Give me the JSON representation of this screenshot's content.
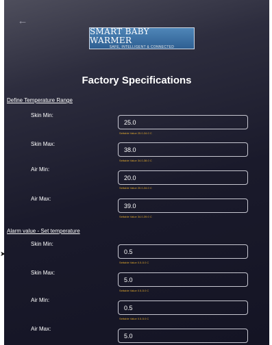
{
  "app": {
    "back_icon": "arrow-left-icon",
    "logo_title": "SMART BABY WARMER",
    "logo_tagline": "SAFE, INTELLIGENT & CONNECTED"
  },
  "page_title": "Factory Specifications",
  "temperature_range": {
    "title": "Define Temperature Range",
    "fields": [
      {
        "label": "Skin Min:",
        "value": "25.0",
        "hint": "Settable Value 25.0-34.0 C"
      },
      {
        "label": "Skin Max:",
        "value": "38.0",
        "hint": "Settable Value 34.0-38.0 C"
      },
      {
        "label": "Air Min:",
        "value": "20.0",
        "hint": "Settable Value 20.0-34.0 C"
      },
      {
        "label": "Air Max:",
        "value": "39.0",
        "hint": "Settable Value 34.0-39.0 C"
      }
    ]
  },
  "alarm_value": {
    "title": "Alarm value - Set temperature",
    "fields": [
      {
        "label": "Skin Min:",
        "value": "0.5",
        "hint": "Settable Value 0.5-5.0 C"
      },
      {
        "label": "Skin Max:",
        "value": "5.0",
        "hint": "Settable Value 0.5-5.0 C"
      },
      {
        "label": "Air Min:",
        "value": "0.5",
        "hint": "Settable Value 0.5-5.0 C"
      },
      {
        "label": "Air Max:",
        "value": "5.0",
        "hint": ""
      }
    ]
  },
  "colors": {
    "background": "#1a1a2b",
    "hint_text": "#e0a82e",
    "logo_bg": "#3a6ea5"
  }
}
